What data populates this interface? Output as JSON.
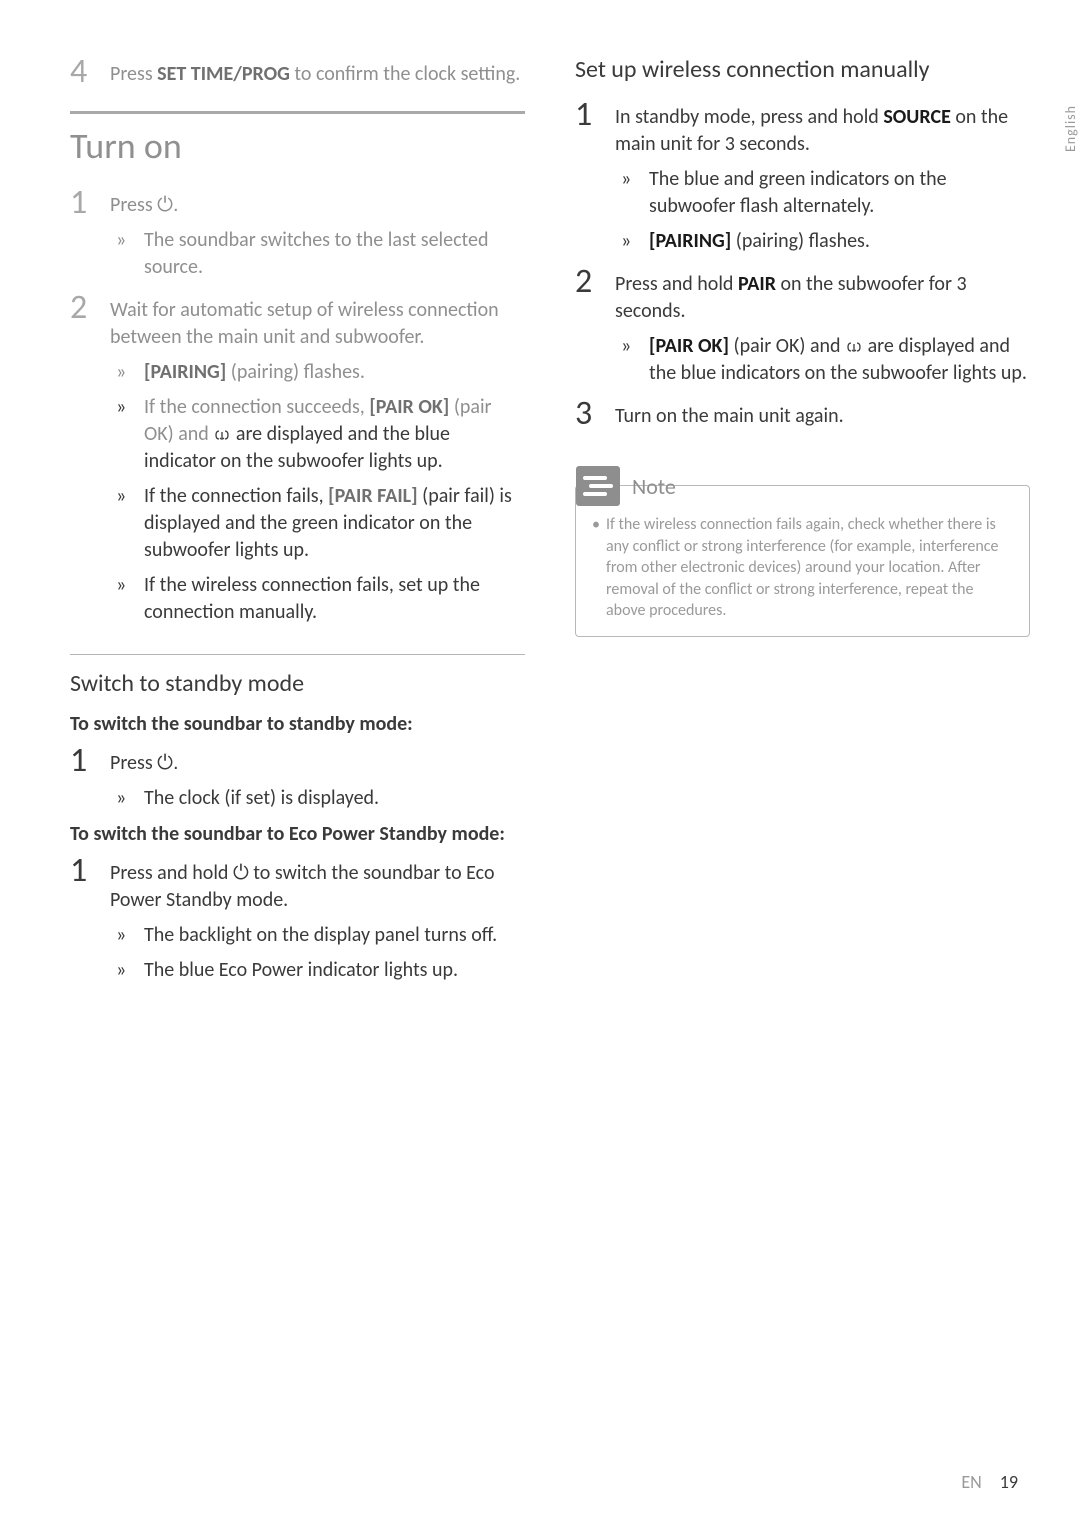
{
  "side_label": "English",
  "left": {
    "step4_num": "4",
    "step4_text_a": "Press ",
    "step4_bold": "SET TIME/PROG",
    "step4_text_b": " to confirm the clock setting.",
    "turn_on_heading": "Turn on",
    "t1_num": "1",
    "t1_text": "Press ",
    "t1_icon_name": "⏻.",
    "t1_sub1": "The soundbar switches to the last selected source.",
    "t2_num": "2",
    "t2_text": "Wait for automatic setup of wireless connection between the main unit and subwoofer.",
    "t2_sub1_a": "",
    "t2_sub1_bold": "[PAIRING]",
    "t2_sub1_b": " (pairing) flashes.",
    "t2_sub2_a": "If the connection succeeds, ",
    "t2_sub2_bold": "[PAIR OK]",
    "t2_sub2_b": " (pair OK) and ",
    "t2_sub2_c": " are displayed and the blue indicator on the subwoofer lights up.",
    "t2_sub3_a": "If the connection fails, ",
    "t2_sub3_bold": "[PAIR FAIL]",
    "t2_sub3_b": " (pair fail) is displayed and the green indicator on the subwoofer lights up.",
    "t2_sub4": "If the wireless connection fails, set up the connection manually.",
    "standby_heading": "Switch to standby mode",
    "standby_sub1": "To switch the soundbar to standby mode:",
    "s1_num": "1",
    "s1_text": "Press ",
    "s1_icon": "⏻.",
    "s1_sub1": "The clock (if set) is displayed.",
    "standby_sub2": "To switch the soundbar to Eco Power Standby mode:",
    "e1_num": "1",
    "e1_text_a": "Press and hold ",
    "e1_icon": "⏻",
    "e1_text_b": " to switch the soundbar to Eco Power Standby mode.",
    "e1_sub1": "The backlight on the display panel turns off.",
    "e1_sub2": "The blue Eco Power indicator lights up."
  },
  "right": {
    "heading": "Set up wireless connection manually",
    "r1_num": "1",
    "r1_a": "In standby mode, press and hold ",
    "r1_bold": "SOURCE",
    "r1_b": " on the main unit for 3 seconds.",
    "r1_sub1": "The blue and green indicators on the subwoofer flash alternately.",
    "r1_sub2_bold": "[PAIRING]",
    "r1_sub2_b": " (pairing) flashes.",
    "r2_num": "2",
    "r2_a": "Press and hold ",
    "r2_bold": "PAIR",
    "r2_b": " on the subwoofer for 3 seconds.",
    "r2_sub1_bold": "[PAIR OK]",
    "r2_sub1_a": " (pair OK) and ",
    "r2_sub1_b": " are displayed and the blue indicators on the subwoofer lights up.",
    "r3_num": "3",
    "r3_text": "Turn on the main unit again.",
    "note_title": "Note",
    "note_body": "If the wireless connection fails again, check whether there is any conflict or strong interference (for example, interference from other electronic devices) around your location. After removal of the conflict or strong interference, repeat the above procedures."
  },
  "footer": {
    "en": "EN",
    "page": "19"
  }
}
